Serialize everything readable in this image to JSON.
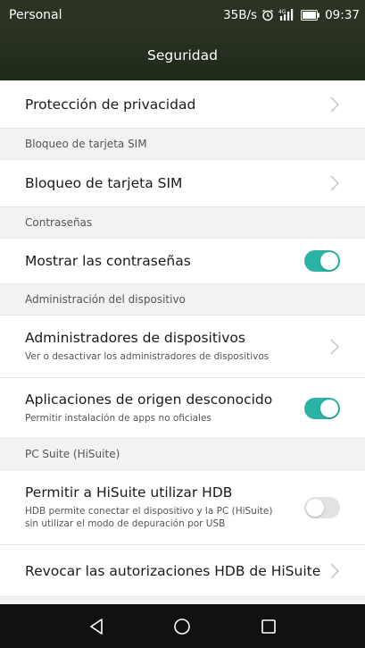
{
  "status_bar": {
    "carrier": "Personal",
    "speed": "35B/s",
    "time": "09:37",
    "icons": [
      "alarm-icon",
      "signal-4g-icon",
      "battery-icon"
    ]
  },
  "header": {
    "title": "Seguridad"
  },
  "colors": {
    "accent": "#2bb4a6",
    "header_bg": "#2b3422",
    "section_bg": "#f2f2f2"
  },
  "list": {
    "privacy": {
      "title": "Protección de privacidad"
    },
    "section_sim": "Bloqueo de tarjeta SIM",
    "sim_lock": {
      "title": "Bloqueo de tarjeta SIM"
    },
    "section_passwords": "Contraseñas",
    "show_passwords": {
      "title": "Mostrar las contraseñas",
      "enabled": true
    },
    "section_device_admin": "Administración del dispositivo",
    "device_admins": {
      "title": "Administradores de dispositivos",
      "subtitle": "Ver o desactivar los administradores de dispositivos"
    },
    "unknown_sources": {
      "title": "Aplicaciones de origen desconocido",
      "subtitle": "Permitir instalación de apps no oficiales",
      "enabled": true
    },
    "section_pc_suite": "PC Suite (HiSuite)",
    "hisuite_hdb": {
      "title": "Permitir a HiSuite utilizar HDB",
      "subtitle_line1": "HDB permite conectar el dispositivo y la PC (HiSuite)",
      "subtitle_line2": "sin utilizar el modo de depuración por USB",
      "enabled": false
    },
    "revoke_hdb": {
      "title": "Revocar las autorizaciones HDB de HiSuite"
    }
  },
  "nav_bar": {
    "buttons": [
      "back-icon",
      "home-icon",
      "recents-icon"
    ]
  }
}
